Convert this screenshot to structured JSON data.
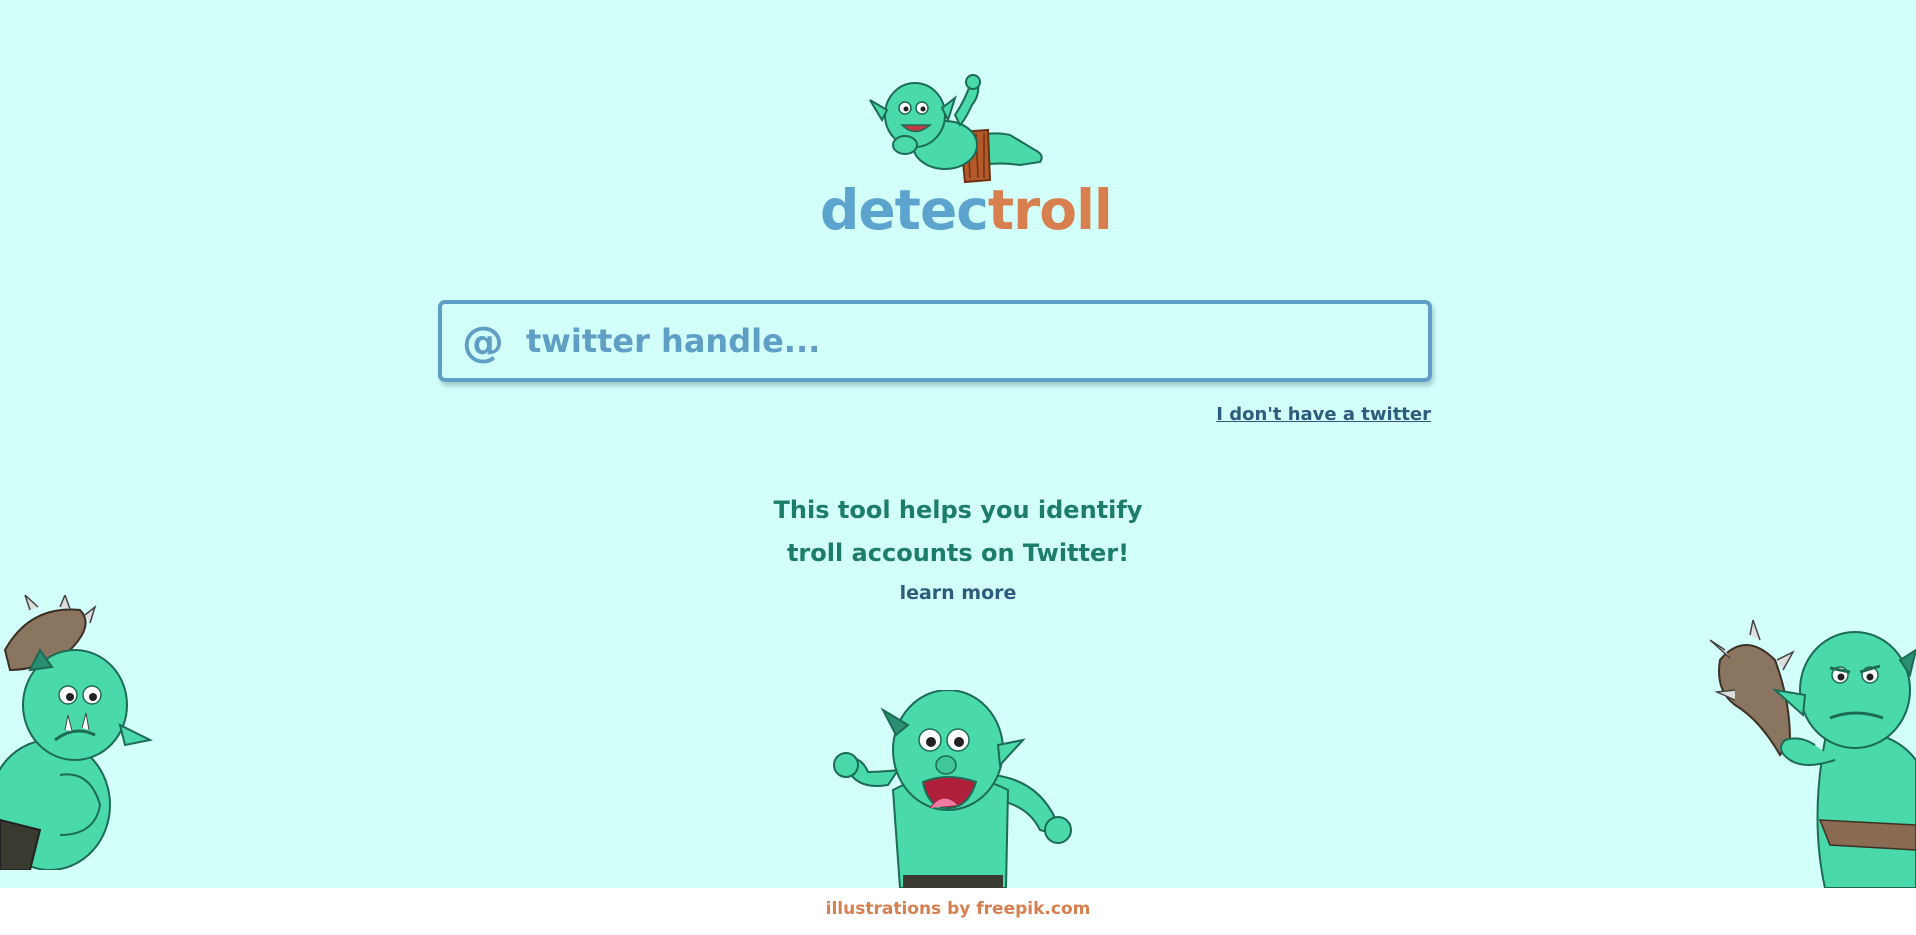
{
  "header": {
    "logo_part_1": "detec",
    "logo_part_2": "troll"
  },
  "search": {
    "prefix": "@",
    "placeholder": "twitter handle..."
  },
  "links": {
    "no_twitter": "I don't have a twitter",
    "learn_more": "learn more"
  },
  "intro": {
    "line_1": "This tool helps you identify",
    "line_2": "troll accounts on Twitter!"
  },
  "footer": {
    "credit": "illustrations by freepik.com"
  },
  "illustrations": {
    "logo": "reclining-troll-icon",
    "left": "troll-with-club-icon",
    "center": "screaming-troll-icon",
    "right": "troll-with-club-icon"
  },
  "colors": {
    "background": "#d3fffb",
    "logo_blue": "#5ca4cd",
    "logo_orange": "#d77f4f",
    "search_border": "#5f9fc6",
    "tagline": "#1c7d6a",
    "link": "#2f5b7c",
    "footer_text": "#d77f4f"
  }
}
